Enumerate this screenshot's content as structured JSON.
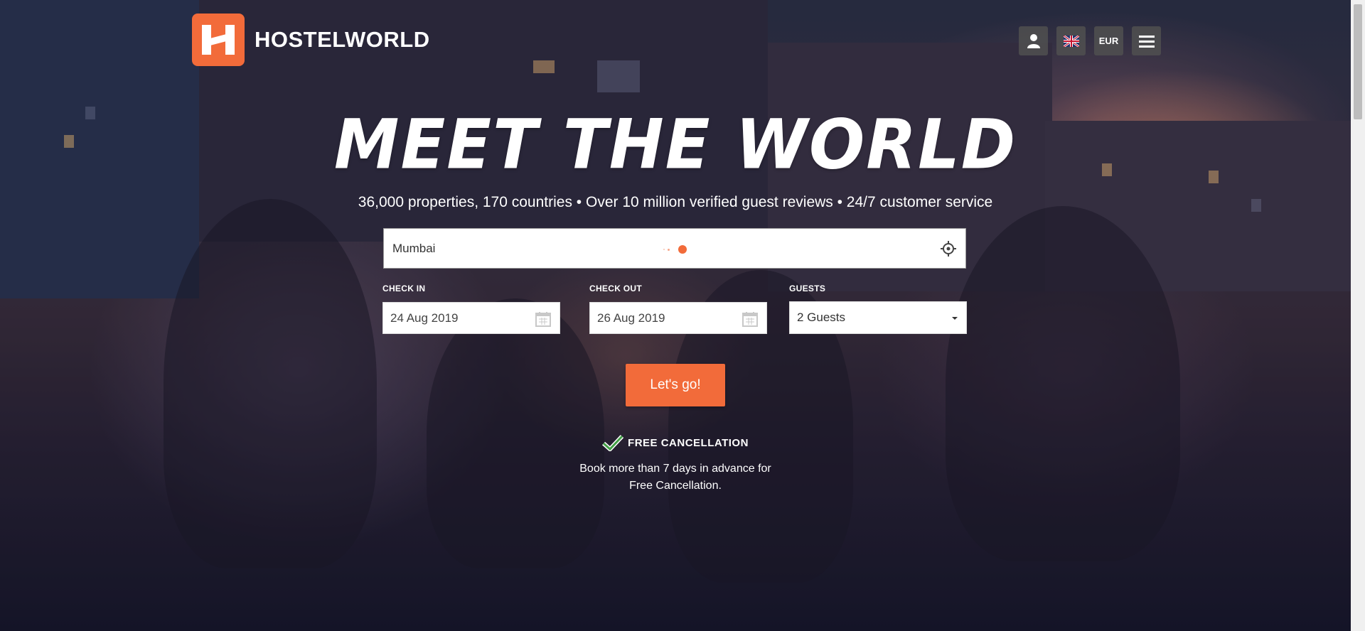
{
  "brand": {
    "name": "HOSTELWORLD",
    "color": "#f26b3a"
  },
  "header": {
    "icons": [
      "user-icon",
      "uk-flag-icon",
      "menu-icon"
    ],
    "currency_label": "EUR"
  },
  "hero": {
    "headline": "MEET THE WORLD",
    "tagline": "36,000 properties, 170 countries • Over 10 million verified guest reviews • 24/7 customer service"
  },
  "search": {
    "destination_value": "Mumbai",
    "location_icon": "crosshair-icon",
    "check_in_label": "CHECK IN",
    "check_in_value": "24 Aug 2019",
    "check_out_label": "CHECK OUT",
    "check_out_value": "26 Aug 2019",
    "guests_label": "GUESTS",
    "guests_value": "2 Guests",
    "submit_label": "Let's go!"
  },
  "free_cancellation": {
    "title": "FREE CANCELLATION",
    "line1": "Book more than 7 days in advance for",
    "line2": "Free Cancellation."
  }
}
